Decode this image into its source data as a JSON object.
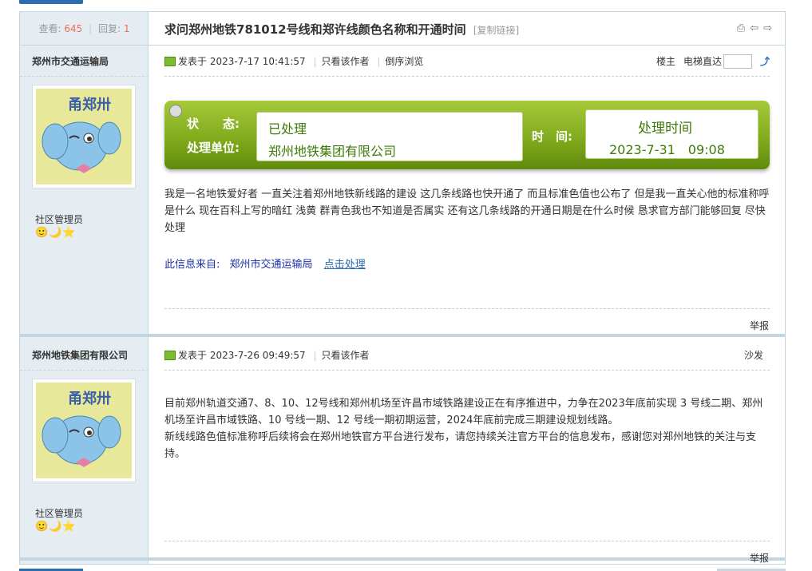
{
  "header": {
    "views_label": "查看:",
    "views": "645",
    "replies_label": "回复:",
    "replies": "1",
    "title": "求问郑州地铁781012号线和郑许线颜色名称和开通时间",
    "copy_link": "[复制链接]"
  },
  "posts": [
    {
      "author": "郑州市交通运输局",
      "role": "社区管理员",
      "posted_prefix": "发表于",
      "posted_time": "2023-7-17 10:41:57",
      "only_author": "只看该作者",
      "reverse": "倒序浏览",
      "floor": "楼主",
      "elevator": "电梯直达",
      "status_label": "状　　态:",
      "status_value": "已处理",
      "unit_label": "处理单位:",
      "unit_value": "郑州地铁集团有限公司",
      "time_label": "时　间:",
      "time_title": "处理时间",
      "time_value": "2023-7-31　09:08",
      "body": "我是一名地铁爱好者 一直关注着郑州地铁新线路的建设 这几条线路也快开通了 而且标准色值也公布了 但是我一直关心他的标准称呼是什么 现在百科上写的暗红 浅黄 群青色我也不知道是否属实 还有这几条线路的开通日期是在什么时候 恳求官方部门能够回复 尽快处理",
      "source_label": "此信息来自:",
      "source_value": "郑州市交通运输局",
      "handle_link": "点击处理",
      "report": "举报"
    },
    {
      "author": "郑州地铁集团有限公司",
      "role": "社区管理员",
      "posted_prefix": "发表于",
      "posted_time": "2023-7-26 09:49:57",
      "only_author": "只看该作者",
      "floor": "沙发",
      "body_line1": "目前郑州轨道交通7、8、10、12号线和郑州机场至许昌市域铁路建设正在有序推进中，力争在2023年底前实现 3 号线二期、郑州机场至许昌市域铁路、10 号线一期、12 号线一期初期运营，2024年底前完成三期建设规划线路。",
      "body_line2": "新线线路色值标准称呼后续将会在郑州地铁官方平台进行发布，请您持续关注官方平台的信息发布，感谢您对郑州地铁的关注与支持。",
      "report": "举报"
    }
  ],
  "avatar_text": "甬郑卅",
  "stars": "🙂🌙⭐"
}
